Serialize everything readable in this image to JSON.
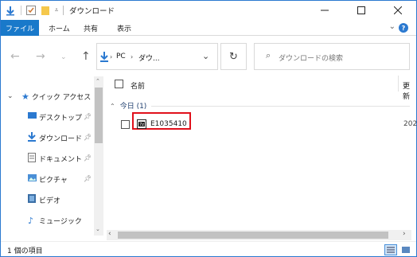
{
  "window": {
    "title": "ダウンロード"
  },
  "ribbon": {
    "file": "ファイル",
    "home": "ホーム",
    "share": "共有",
    "view": "表示",
    "help": "?"
  },
  "address": {
    "crumb_pc": "PC",
    "crumb_folder": "ダウ..."
  },
  "search": {
    "placeholder": "ダウンロードの検索"
  },
  "nav": {
    "quick_access": "クイック アクセス",
    "items": [
      {
        "label": "デスクトップ",
        "pinned": true
      },
      {
        "label": "ダウンロード",
        "pinned": true
      },
      {
        "label": "ドキュメント",
        "pinned": true
      },
      {
        "label": "ピクチャ",
        "pinned": true
      },
      {
        "label": "ビデオ",
        "pinned": false
      },
      {
        "label": "ミュージック",
        "pinned": false
      }
    ]
  },
  "content": {
    "col_name": "名前",
    "col_date": "更新",
    "group_label": "今日 (1)",
    "files": [
      {
        "name": "E1035410",
        "date": "202"
      }
    ]
  },
  "status": {
    "count": "1 個の項目"
  },
  "colors": {
    "accent": "#1979ca",
    "highlight": "#e0101b"
  }
}
